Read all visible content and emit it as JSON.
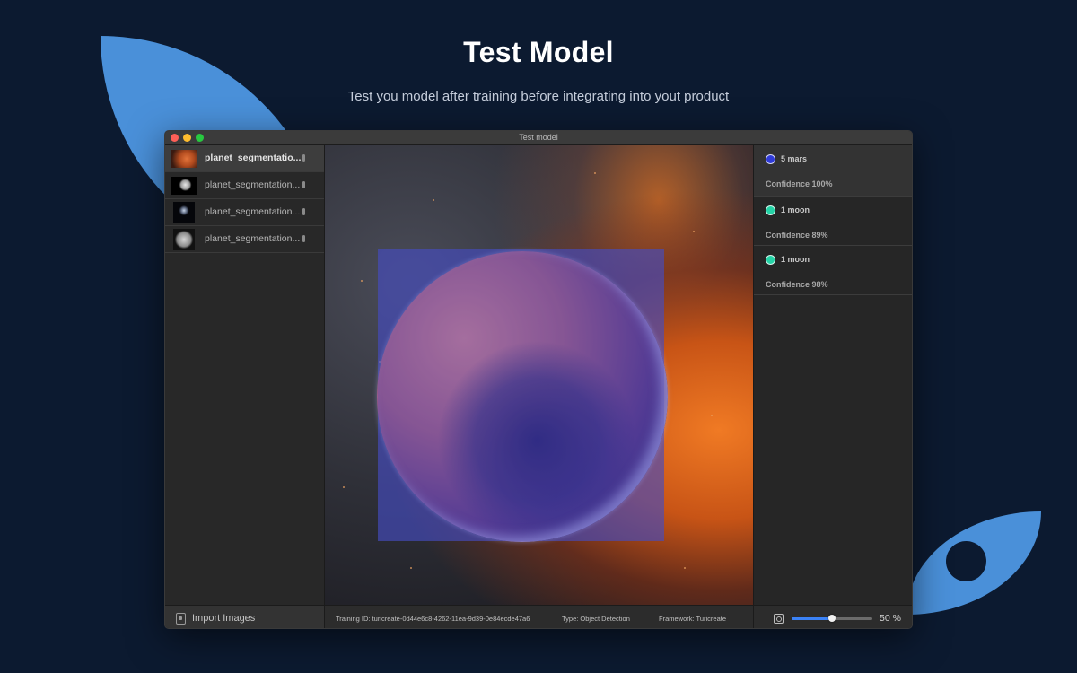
{
  "hero": {
    "title": "Test Model",
    "subtitle": "Test you model after training before integrating into yout product"
  },
  "window": {
    "title": "Test model"
  },
  "sidebar": {
    "files": [
      {
        "name": "planet_segmentatio...",
        "selected": true
      },
      {
        "name": "planet_segmentation...",
        "selected": false
      },
      {
        "name": "planet_segmentation...",
        "selected": false
      },
      {
        "name": "planet_segmentation...",
        "selected": false
      }
    ],
    "import_label": "Import Images"
  },
  "footer": {
    "training_id": "Training ID: turicreate-0d44e6c8-4262-11ea-9d39-0e84ecde47a6",
    "type": "Type: Object Detection",
    "framework": "Framework: Turicreate"
  },
  "results": [
    {
      "label": "5 mars",
      "confidence": "Confidence 100%",
      "color": "#2f3bd8",
      "selected": true
    },
    {
      "label": "1 moon",
      "confidence": "Confidence 89%",
      "color": "#24d3a6",
      "selected": false
    },
    {
      "label": "1 moon",
      "confidence": "Confidence 98%",
      "color": "#24d3a6",
      "selected": false
    }
  ],
  "zoom": {
    "label": "50 %",
    "value": 0.5
  },
  "colors": {
    "background": "#0c1a30",
    "accent": "#4a90d9",
    "slider": "#3b82f6"
  }
}
